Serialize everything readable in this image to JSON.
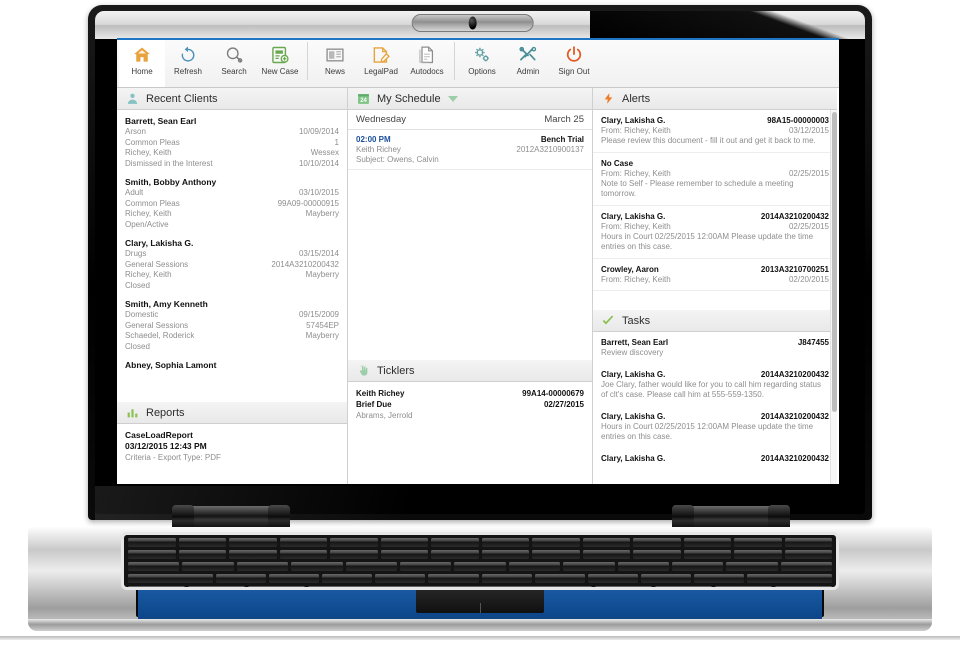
{
  "toolbar": {
    "items": [
      {
        "label": "Home",
        "icon": "home-icon",
        "active": true
      },
      {
        "label": "Refresh",
        "icon": "refresh-icon",
        "active": false
      },
      {
        "label": "Search",
        "icon": "search-icon",
        "active": false
      },
      {
        "label": "New Case",
        "icon": "new-case-icon",
        "active": false
      },
      {
        "label": "News",
        "icon": "news-icon",
        "active": false
      },
      {
        "label": "LegalPad",
        "icon": "legalpad-icon",
        "active": false
      },
      {
        "label": "Autodocs",
        "icon": "autodocs-icon",
        "active": false
      },
      {
        "label": "Options",
        "icon": "gear-icon",
        "active": false
      },
      {
        "label": "Admin",
        "icon": "tools-icon",
        "active": false
      },
      {
        "label": "Sign Out",
        "icon": "power-icon",
        "active": false
      }
    ]
  },
  "colors": {
    "home_accent": "#e8a33d",
    "refresh_accent": "#4a90b8",
    "new_case_accent": "#6aa84f",
    "legalpad_accent": "#e8a33d",
    "power_accent": "#e05a20",
    "alert_accent": "#f07c28",
    "task_accent": "#8cc152",
    "client_accent": "#86c2c2",
    "schedule_accent": "#7ec485",
    "report_accent": "#8cc152",
    "time_blue": "#1a4f9c",
    "screen_topline": "#1d76c4",
    "trackpad_blue": "#0f4b90"
  },
  "recent_clients": {
    "title": "Recent Clients",
    "icon": "person-icon",
    "items": [
      {
        "name": "Barrett, Sean Earl",
        "rows": [
          {
            "left": "Arson",
            "right": "10/09/2014"
          },
          {
            "left": "Common Pleas",
            "right": "1"
          },
          {
            "left": "Richey, Keith",
            "right": "Wessex"
          },
          {
            "left": "Dismissed in the Interest",
            "right": "10/10/2014"
          }
        ]
      },
      {
        "name": "Smith, Bobby Anthony",
        "rows": [
          {
            "left": "Adult",
            "right": "03/10/2015"
          },
          {
            "left": "Common Pleas",
            "right": "99A09-00000915"
          },
          {
            "left": "Richey, Keith",
            "right": "Mayberry"
          },
          {
            "left": "Open/Active",
            "right": ""
          }
        ]
      },
      {
        "name": "Clary, Lakisha G.",
        "rows": [
          {
            "left": "Drugs",
            "right": "03/15/2014"
          },
          {
            "left": "General Sessions",
            "right": "2014A3210200432"
          },
          {
            "left": "Richey, Keith",
            "right": "Mayberry"
          },
          {
            "left": "Closed",
            "right": ""
          }
        ]
      },
      {
        "name": "Smith, Amy Kenneth",
        "rows": [
          {
            "left": "Domestic",
            "right": "09/15/2009"
          },
          {
            "left": "General Sessions",
            "right": "57454EP"
          },
          {
            "left": "Schaedel, Roderick",
            "right": "Mayberry"
          },
          {
            "left": "Closed",
            "right": ""
          }
        ]
      },
      {
        "name": "Abney, Sophia Lamont",
        "rows": []
      }
    ]
  },
  "reports": {
    "title": "Reports",
    "icon": "bar-chart-icon",
    "items": [
      {
        "name": "CaseLoadReport",
        "timestamp": "03/12/2015 12:43 PM",
        "subtitle": "Criteria - Export Type: PDF"
      }
    ]
  },
  "my_schedule": {
    "title": "My Schedule",
    "icon": "calendar-icon",
    "calendar_day": "24",
    "has_dropdown": true,
    "day_label": "Wednesday",
    "date_label": "March 25",
    "events": [
      {
        "time": "02:00 PM",
        "kind": "Bench Trial",
        "person": "Keith Richey",
        "case_number": "2012A3210900137",
        "subject": "Subject: Owens, Calvin"
      }
    ]
  },
  "ticklers": {
    "title": "Ticklers",
    "icon": "hand-pointer-icon",
    "items": [
      {
        "person": "Keith Richey",
        "case_number": "99A14-00000679",
        "type": "Brief Due",
        "date": "02/27/2015",
        "subject": "Abrams, Jerrold"
      }
    ]
  },
  "alerts": {
    "title": "Alerts",
    "icon": "lightning-bolt-icon",
    "items": [
      {
        "name": "Clary, Lakisha G.",
        "case_number": "98A15-00000003",
        "from": "From: Richey, Keith",
        "date": "03/12/2015",
        "body": "Please review this document - fill it out and get it back to me."
      },
      {
        "name": "No Case",
        "case_number": "",
        "from": "From: Richey, Keith",
        "date": "02/25/2015",
        "body": "Note to Self - Please remember to schedule a meeting tomorrow."
      },
      {
        "name": "Clary, Lakisha G.",
        "case_number": "2014A3210200432",
        "from": "From: Richey, Keith",
        "date": "02/25/2015",
        "body": "Hours in Court 02/25/2015 12:00AM Please update the time entries on this case."
      },
      {
        "name": "Crowley, Aaron",
        "case_number": "2013A3210700251",
        "from": "From: Richey, Keith",
        "date": "02/20/2015",
        "body": ""
      }
    ]
  },
  "tasks": {
    "title": "Tasks",
    "icon": "check-icon",
    "items": [
      {
        "name": "Barrett, Sean Earl",
        "case_number": "J847455",
        "body": "Review discovery"
      },
      {
        "name": "Clary, Lakisha G.",
        "case_number": "2014A3210200432",
        "body": "Joe Clary, father would like for you to call him regarding status of clt's case.  Please call him at 555-559-1350."
      },
      {
        "name": "Clary, Lakisha G.",
        "case_number": "2014A3210200432",
        "body": "Hours in Court 02/25/2015 12:00AM Please update the time entries on this case."
      },
      {
        "name": "Clary, Lakisha G.",
        "case_number": "2014A3210200432",
        "body": ""
      }
    ]
  }
}
